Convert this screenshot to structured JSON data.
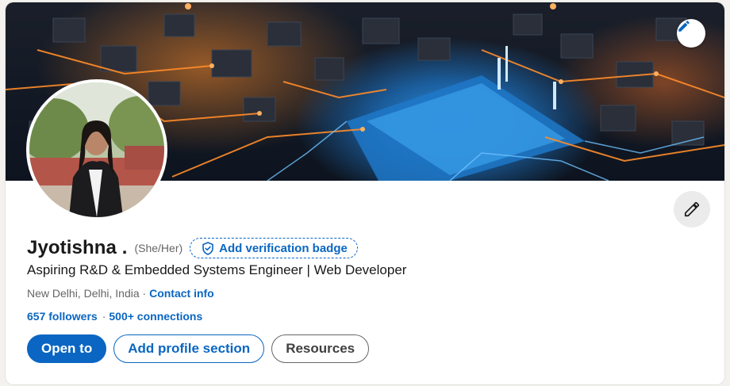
{
  "profile": {
    "name": "Jyotishna .",
    "pronouns": "(She/Her)",
    "verification_badge_label": "Add verification badge",
    "headline": "Aspiring R&D & Embedded Systems Engineer | Web Developer",
    "location": "New Delhi, Delhi, India",
    "location_separator": " · ",
    "contact_info_label": "Contact info",
    "followers": "657 followers",
    "stats_separator": "·",
    "connections": "500+ connections"
  },
  "actions": {
    "open_to_label": "Open to",
    "add_profile_section_label": "Add profile section",
    "resources_label": "Resources"
  },
  "icons": {
    "banner_edit": "pencil-icon",
    "intro_edit": "pencil-icon",
    "verification": "shield-check-icon"
  },
  "colors": {
    "brand_blue": "#0a66c2",
    "text_primary": "#191919",
    "text_secondary": "#666666",
    "page_background": "#f4f2ee"
  }
}
